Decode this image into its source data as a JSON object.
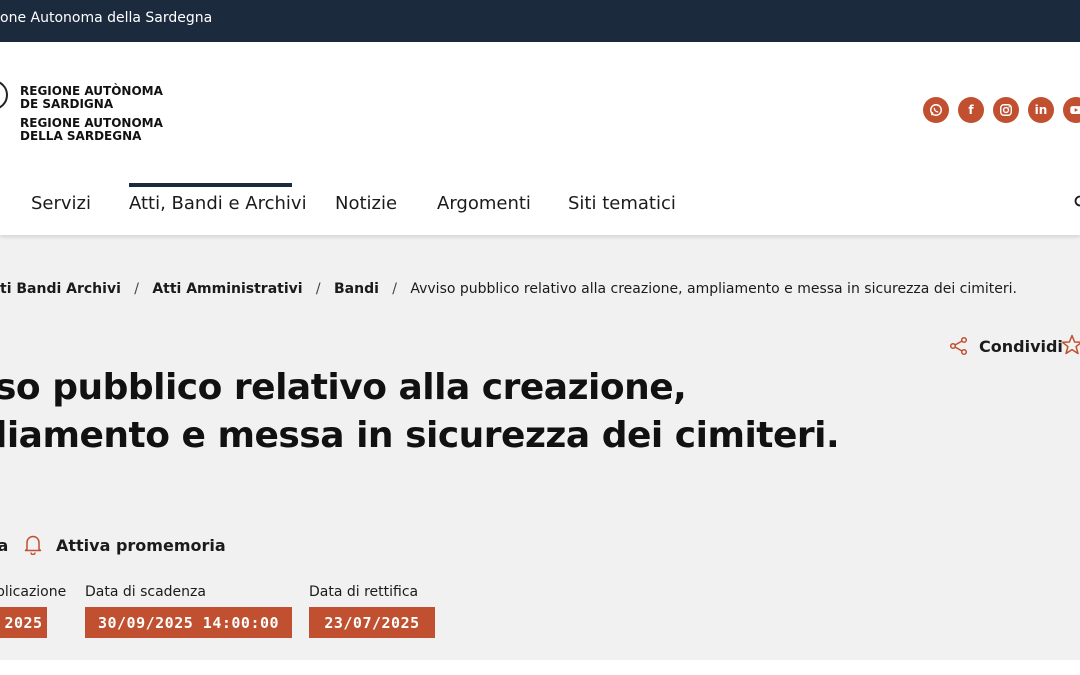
{
  "topbar": {
    "text": "one Autonoma della Sardegna"
  },
  "logo": {
    "line1a": "REGIONE AUTÒNOMA",
    "line1b": "DE SARDIGNA",
    "line2a": "REGIONE AUTONOMA",
    "line2b": "DELLA SARDEGNA"
  },
  "social": [
    {
      "name": "whatsapp-icon",
      "glyph": ""
    },
    {
      "name": "facebook-icon",
      "glyph": "f"
    },
    {
      "name": "instagram-icon",
      "glyph": ""
    },
    {
      "name": "linkedin-icon",
      "glyph": "in"
    },
    {
      "name": "youtube-icon",
      "glyph": ""
    }
  ],
  "nav": {
    "items": [
      "Servizi",
      "Atti, Bandi e Archivi",
      "Notizie",
      "Argomenti",
      "Siti tematici"
    ],
    "active_index": 1
  },
  "breadcrumb": {
    "items": [
      "ti Bandi Archivi",
      "Atti Amministrativi",
      "Bandi"
    ],
    "current": "Avviso pubblico relativo alla creazione, ampliamento e messa in sicurezza dei cimiteri."
  },
  "share": {
    "label": "Condividi"
  },
  "page": {
    "title_line1": "so pubblico relativo alla creazione,",
    "title_line2": "liamento e messa in sicurezza dei cimiteri."
  },
  "actions": {
    "cut_label": "pa",
    "reminder": "Attiva promemoria"
  },
  "dates": {
    "publish_label": "plicazione",
    "publish_value": "2025",
    "deadline_label": "Data di scadenza",
    "deadline_value": "30/09/2025 14:00:00",
    "rectify_label": "Data di rettifica",
    "rectify_value": "23/07/2025"
  },
  "colors": {
    "accent": "#c0502f",
    "navy": "#1c2a3e",
    "background": "#f1f1f1"
  }
}
